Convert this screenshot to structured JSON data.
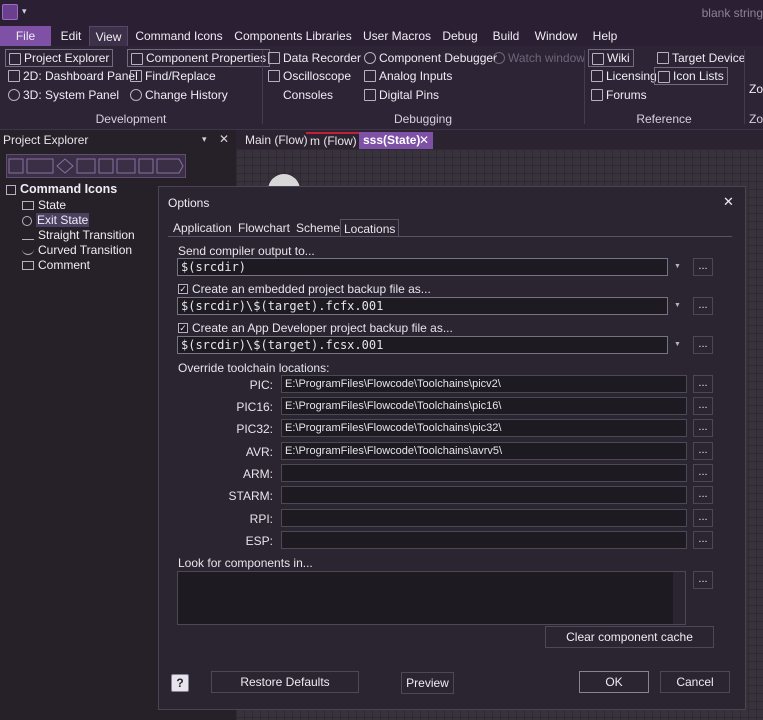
{
  "app": {
    "window_title": "blank string",
    "qa_arrow": "▾"
  },
  "menus": [
    "File",
    "Edit",
    "View",
    "Command Icons",
    "Components Libraries",
    "User Macros",
    "Debug",
    "Build",
    "Window",
    "Help"
  ],
  "ribbon": {
    "development": {
      "label": "Development",
      "items": [
        "Project Explorer",
        "2D: Dashboard Panel",
        "3D: System Panel",
        "Component Properties",
        "Find/Replace",
        "Change History"
      ]
    },
    "debugging": {
      "label": "Debugging",
      "items": [
        "Data Recorder",
        "Oscilloscope",
        "Consoles",
        "Component Debugger",
        "Analog Inputs",
        "Digital Pins",
        "Watch window"
      ]
    },
    "reference": {
      "label": "Reference",
      "items": [
        "Wiki",
        "Licensing",
        "Forums",
        "Target Device",
        "Icon Lists"
      ]
    },
    "zoom": {
      "short_label": "Zo",
      "group_short": "Zo"
    }
  },
  "project_explorer": {
    "title": "Project Explorer",
    "dropdown": "▾",
    "close": "✕",
    "root": "Command Icons",
    "items": [
      "State",
      "Exit State",
      "Straight Transition",
      "Curved Transition",
      "Comment"
    ]
  },
  "doc_tabs": [
    "Main (Flow)",
    "m (Flow)",
    "sss(State)"
  ],
  "doc_tab_close": "✕",
  "dialog": {
    "title": "Options",
    "close": "✕",
    "tabs": [
      "Application",
      "Flowchart",
      "Scheme",
      "Locations"
    ],
    "active_tab": "Locations",
    "compiler_output": {
      "label": "Send compiler output to...",
      "value": "$(srcdir)"
    },
    "embedded_backup": {
      "label": "Create an embedded project backup file as...",
      "checked": true,
      "value": "$(srcdir)\\$(target).fcfx.001"
    },
    "appdev_backup": {
      "label": "Create an App Developer project backup file as...",
      "checked": true,
      "value": "$(srcdir)\\$(target).fcsx.001"
    },
    "browse": "...",
    "check_mark": "✓",
    "combo_arrow": "▼",
    "toolchain_header": "Override toolchain locations:",
    "toolchains": [
      {
        "label": "PIC:",
        "value": "E:\\ProgramFiles\\Flowcode\\Toolchains\\picv2\\"
      },
      {
        "label": "PIC16:",
        "value": "E:\\ProgramFiles\\Flowcode\\Toolchains\\pic16\\"
      },
      {
        "label": "PIC32:",
        "value": "E:\\ProgramFiles\\Flowcode\\Toolchains\\pic32\\"
      },
      {
        "label": "AVR:",
        "value": "E:\\ProgramFiles\\Flowcode\\Toolchains\\avrv5\\"
      },
      {
        "label": "ARM:",
        "value": ""
      },
      {
        "label": "STARM:",
        "value": ""
      },
      {
        "label": "RPI:",
        "value": ""
      },
      {
        "label": "ESP:",
        "value": ""
      }
    ],
    "look_for_components": "Look for components in...",
    "clear_cache": "Clear component cache",
    "help": "?",
    "restore_defaults": "Restore Defaults",
    "preview": "Preview",
    "ok": "OK",
    "cancel": "Cancel"
  },
  "colors": {
    "accent": "#7e50a6",
    "background": "#2b2430",
    "dialog": "#2a2530"
  }
}
